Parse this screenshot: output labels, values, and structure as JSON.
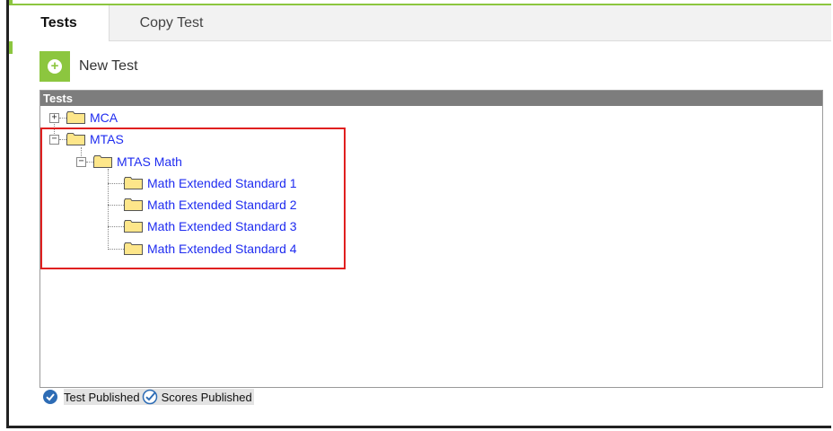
{
  "tabs": [
    {
      "label": "Tests",
      "active": true
    },
    {
      "label": "Copy Test",
      "active": false
    }
  ],
  "toolbar": {
    "new_test_label": "New Test",
    "new_test_icon": "plus-icon"
  },
  "panel": {
    "header": "Tests",
    "tree": {
      "mca": {
        "label": "MCA",
        "expanded": false
      },
      "mtas": {
        "label": "MTAS",
        "expanded": true,
        "math": {
          "label": "MTAS Math",
          "expanded": true,
          "children": [
            {
              "label": "Math Extended Standard 1"
            },
            {
              "label": "Math Extended Standard 2"
            },
            {
              "label": "Math Extended Standard 3"
            },
            {
              "label": "Math Extended Standard 4"
            }
          ]
        }
      }
    }
  },
  "legend": {
    "test_published": "Test Published",
    "scores_published": "Scores Published"
  },
  "colors": {
    "accent_green": "#8cc63f",
    "link_blue": "#1f2cf0",
    "highlight_red": "#e02020",
    "folder_yellow": "#fde68a"
  }
}
